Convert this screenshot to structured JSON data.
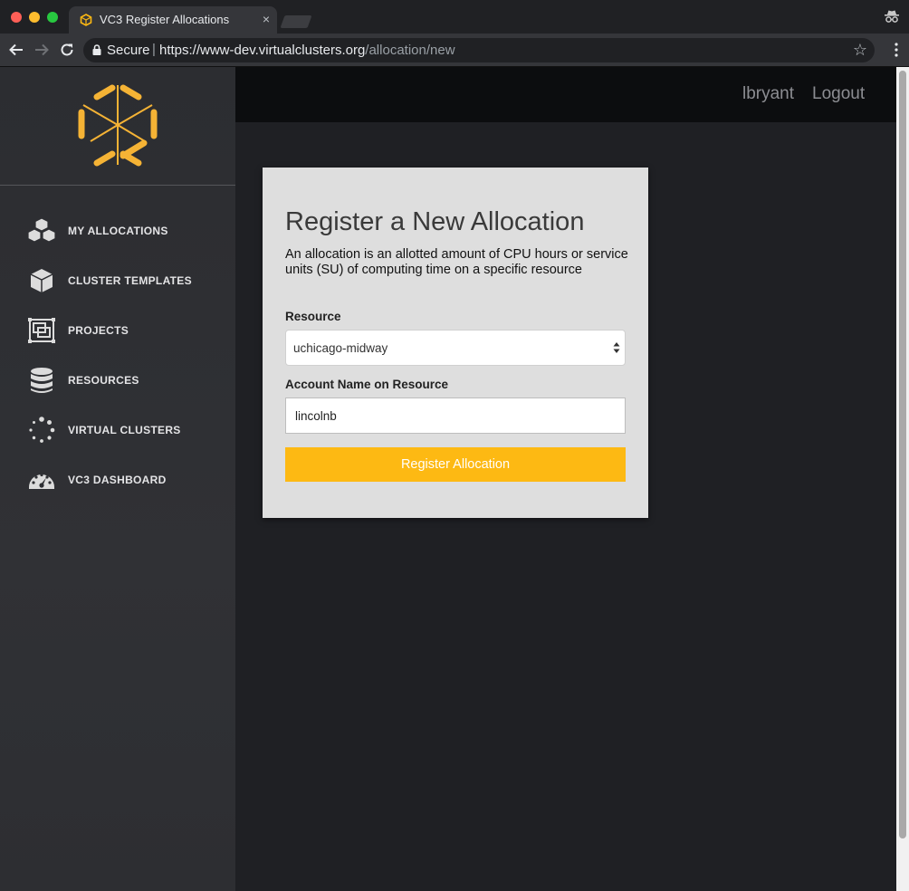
{
  "browser": {
    "tab_title": "VC3 Register Allocations",
    "tab_close": "×",
    "secure_label": "Secure",
    "url_separator": "|",
    "url_base": "https://www-dev.virtualclusters.org",
    "url_path": "/allocation/new",
    "bookmark_icon": "☆"
  },
  "header": {
    "username": "lbryant",
    "logout": "Logout"
  },
  "sidebar": {
    "items": [
      {
        "label": "MY ALLOCATIONS",
        "icon": "cubes-icon"
      },
      {
        "label": "CLUSTER TEMPLATES",
        "icon": "cube-icon"
      },
      {
        "label": "PROJECTS",
        "icon": "projects-icon"
      },
      {
        "label": "RESOURCES",
        "icon": "database-icon"
      },
      {
        "label": "VIRTUAL CLUSTERS",
        "icon": "spinner-icon"
      },
      {
        "label": "VC3 DASHBOARD",
        "icon": "dashboard-icon"
      }
    ]
  },
  "form": {
    "title": "Register a New Allocation",
    "description": "An allocation is an allotted amount of CPU hours or service units (SU) of computing time on a specific resource",
    "resource_label": "Resource",
    "resource_value": "uchicago-midway",
    "account_label": "Account Name on Resource",
    "account_value": "lincolnb",
    "submit_label": "Register Allocation"
  },
  "colors": {
    "accent": "#fdb913",
    "sidebar_bg": "#2e2f33",
    "topbar_bg": "#0c0d0f",
    "card_bg": "#dedede"
  }
}
